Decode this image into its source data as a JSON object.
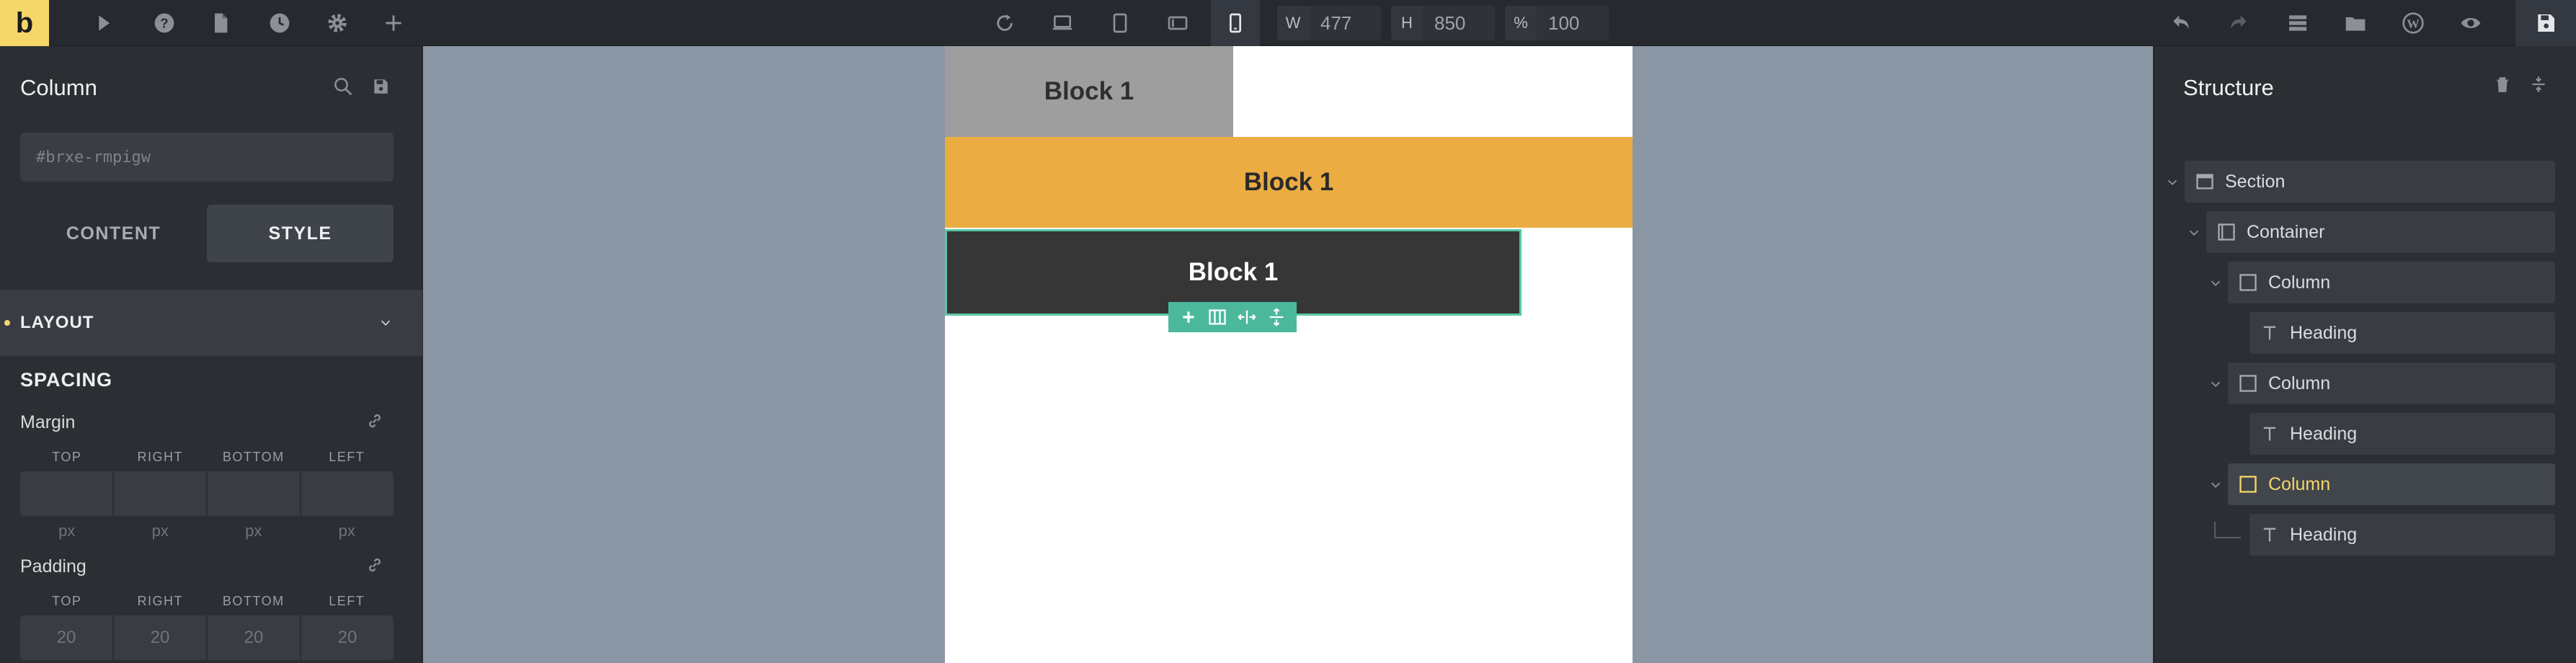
{
  "toolbar": {
    "logo": "b",
    "width_label": "W",
    "width_value": "477",
    "height_label": "H",
    "height_value": "850",
    "zoom_label": "%",
    "zoom_value": "100"
  },
  "left_panel": {
    "title": "Column",
    "css_id": "#brxe-rmpigw",
    "tabs": [
      "CONTENT",
      "STYLE"
    ],
    "active_tab": "STYLE",
    "layout_label": "LAYOUT",
    "spacing_title": "SPACING",
    "margin": {
      "label": "Margin",
      "sides": [
        "TOP",
        "RIGHT",
        "BOTTOM",
        "LEFT"
      ],
      "values": [
        "",
        "",
        "",
        ""
      ],
      "units": [
        "px",
        "px",
        "px",
        "px"
      ]
    },
    "padding": {
      "label": "Padding",
      "sides": [
        "TOP",
        "RIGHT",
        "BOTTOM",
        "LEFT"
      ],
      "values": [
        "20",
        "20",
        "20",
        "20"
      ]
    }
  },
  "canvas": {
    "blocks": [
      {
        "text": "Block 1",
        "color": "#9e9e9e"
      },
      {
        "text": "Block 1",
        "color": "#ebac42"
      },
      {
        "text": "Block 1",
        "color": "#363636"
      }
    ],
    "selection_color": "#4cb89b"
  },
  "structure": {
    "title": "Structure",
    "items": [
      {
        "label": "Section",
        "icon": "section-icon"
      },
      {
        "label": "Container",
        "icon": "container-icon"
      },
      {
        "label": "Column",
        "icon": "column-icon"
      },
      {
        "label": "Heading",
        "icon": "heading-icon"
      },
      {
        "label": "Column",
        "icon": "column-icon"
      },
      {
        "label": "Heading",
        "icon": "heading-icon"
      },
      {
        "label": "Column",
        "icon": "column-icon",
        "selected": true
      },
      {
        "label": "Heading",
        "icon": "heading-icon"
      }
    ]
  },
  "colors": {
    "brand": "#f5d769",
    "panel": "#2b2e33",
    "canvas": "#8a96a3",
    "accent_green": "#4cb89b"
  }
}
